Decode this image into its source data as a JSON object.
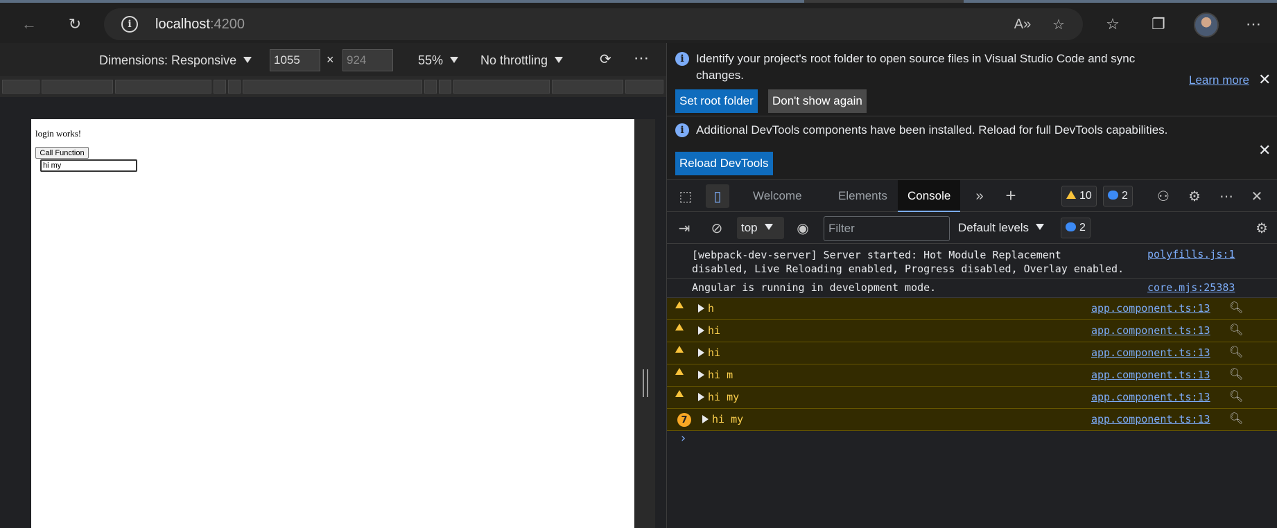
{
  "browser": {
    "address_host": "localhost",
    "address_port": ":4200",
    "icons": [
      "back-icon",
      "refresh-icon",
      "site-info-icon",
      "read-aloud-icon",
      "add-favorite-icon",
      "favorites-icon",
      "collections-icon",
      "profile-avatar",
      "more-icon"
    ]
  },
  "device_toolbar": {
    "dimensions_label": "Dimensions: Responsive",
    "width": "1055",
    "times": "×",
    "height": "924",
    "zoom": "55%",
    "throttling": "No throttling",
    "more": "⋮"
  },
  "page": {
    "text": "login works!",
    "button_label": "Call Function",
    "input_value": "hi my"
  },
  "infobars": [
    {
      "message": "Identify your project's root folder to open source files in Visual Studio Code and sync changes.",
      "primary_button": "Set root folder",
      "secondary_button": "Don't show again",
      "link": "Learn more"
    },
    {
      "message": "Additional DevTools components have been installed. Reload for full DevTools capabilities.",
      "primary_button": "Reload DevTools"
    }
  ],
  "tabs": {
    "welcome": "Welcome",
    "elements": "Elements",
    "console": "Console",
    "warnings_count": "10",
    "messages_count": "2"
  },
  "console_toolbar": {
    "context": "top",
    "filter_placeholder": "Filter",
    "levels": "Default levels",
    "messages_count": "2"
  },
  "console": {
    "entries": [
      {
        "type": "info",
        "message": "[webpack-dev-server] Server started: Hot Module Replacement\ndisabled, Live Reloading enabled, Progress disabled, Overlay enabled.",
        "source": "polyfills.js:1"
      },
      {
        "type": "info",
        "message": "Angular is running in development mode.",
        "source": "core.mjs:25383"
      },
      {
        "type": "warning",
        "message": "h",
        "source": "app.component.ts:13"
      },
      {
        "type": "warning",
        "message": "hi",
        "source": "app.component.ts:13"
      },
      {
        "type": "warning",
        "message": "hi",
        "source": "app.component.ts:13"
      },
      {
        "type": "warning",
        "message": "hi m",
        "source": "app.component.ts:13"
      },
      {
        "type": "warning",
        "message": "hi my",
        "source": "app.component.ts:13"
      },
      {
        "type": "warning",
        "message": "hi my",
        "source": "app.component.ts:13",
        "repeat_count": "7"
      }
    ],
    "prompt": "›"
  }
}
